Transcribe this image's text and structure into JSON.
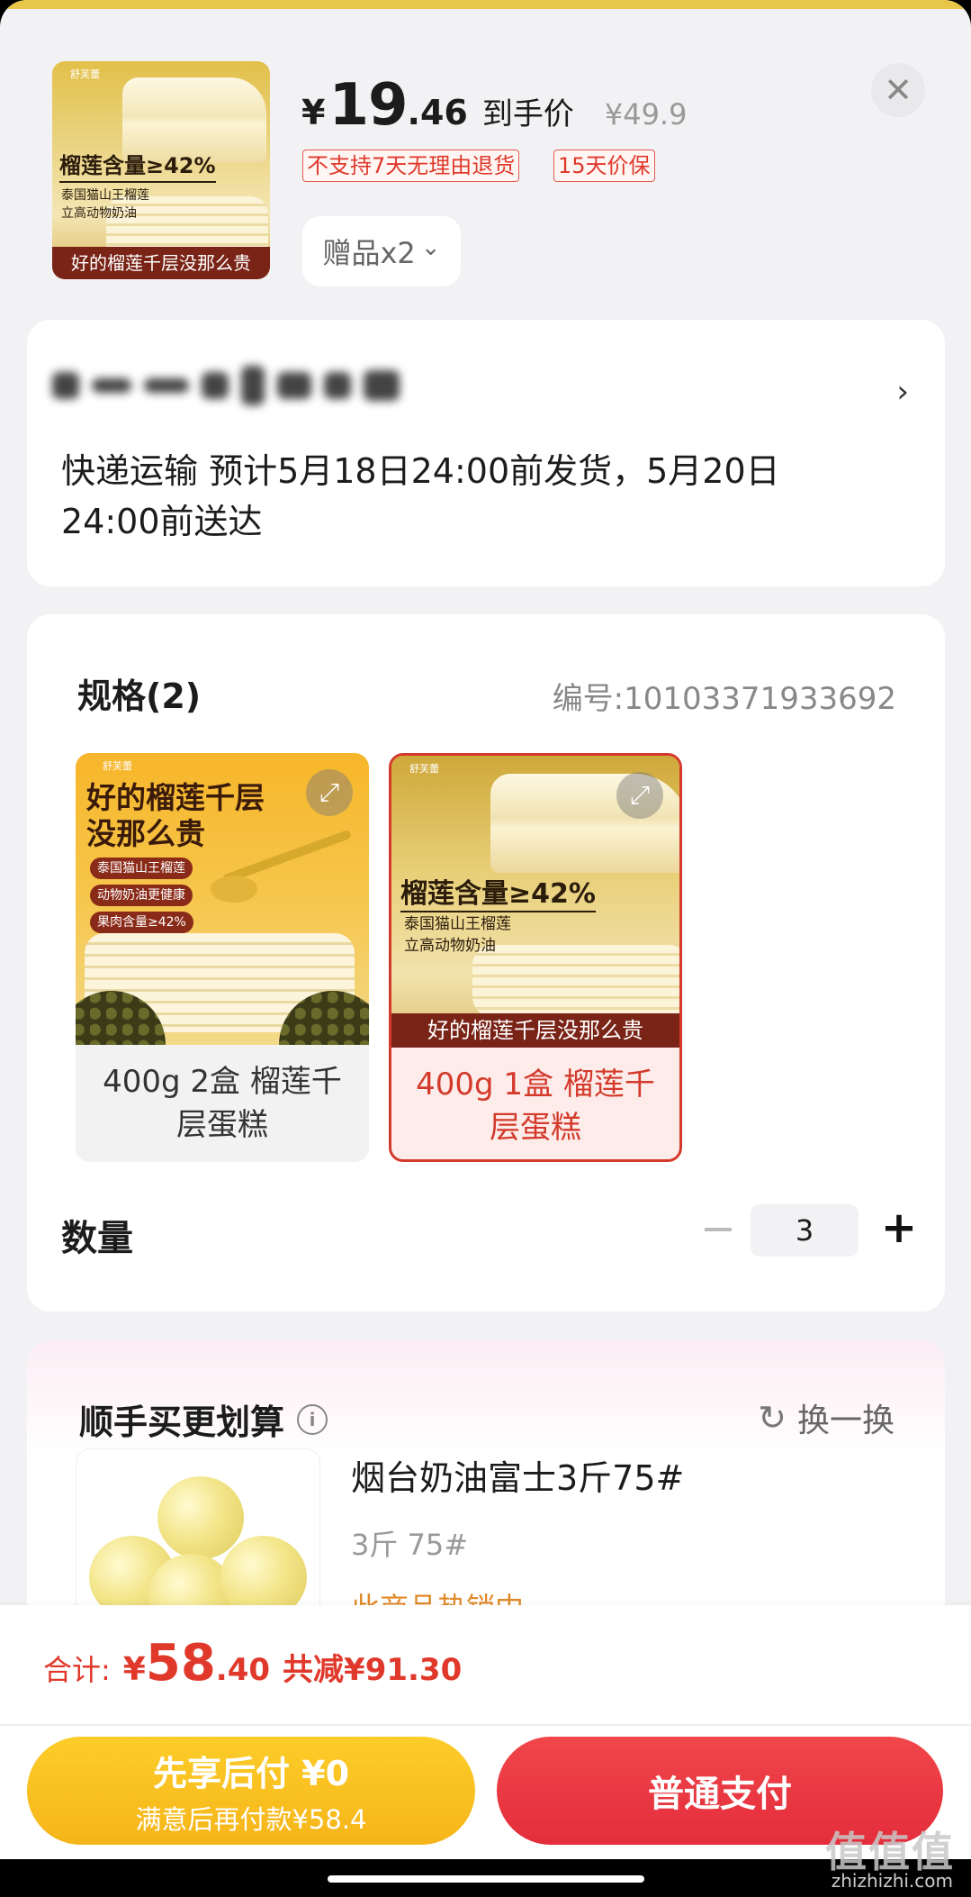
{
  "product": {
    "thumb_logo": "舒芙蕾",
    "thumb_headline": "榴莲含量≥42%",
    "thumb_sub1": "泰国猫山王榴莲",
    "thumb_sub2": "立高动物奶油",
    "thumb_banner": "好的榴莲千层没那么贵",
    "price_yen": "¥",
    "price_int": "19",
    "price_dec": ".46",
    "price_label": "到手价",
    "original_price": "¥49.9",
    "tags": [
      "不支持7天无理由退货",
      "15天价保"
    ],
    "gift_label": "赠品x2",
    "gift_chevron": "⌄",
    "close_glyph": "✕"
  },
  "address": {
    "arrow": "›",
    "shipping_text": "快递运输 预计5月18日24:00前发货，5月20日24:00前送达"
  },
  "spec": {
    "title": "规格(2)",
    "code": "编号:10103371933692",
    "options": [
      {
        "label": "400g 2盒 榴莲千层蛋糕",
        "logo": "舒芙蕾",
        "headline": "好的榴莲千层没那么贵",
        "pills": [
          "泰国猫山王榴莲",
          "动物奶油更健康",
          "果肉含量≥42%"
        ],
        "selected": false
      },
      {
        "label": "400g 1盒 榴莲千层蛋糕",
        "logo": "舒芙蕾",
        "headline": "榴莲含量≥42%",
        "sub1": "泰国猫山王榴莲",
        "sub2": "立高动物奶油",
        "banner": "好的榴莲千层没那么贵",
        "selected": true
      }
    ],
    "expand_glyph": "⤢"
  },
  "quantity": {
    "label": "数量",
    "minus": "−",
    "value": "3",
    "plus": "+"
  },
  "recommend": {
    "title": "顺手买更划算",
    "info_glyph": "i",
    "refresh_label": "换一换",
    "refresh_glyph": "↻",
    "item_name": "烟台奶油富士3斤75#",
    "item_spec": "3斤 75#",
    "item_status": "此商品热销中"
  },
  "checkout": {
    "total_label": "合计:",
    "total_yen": "¥",
    "total_int": "58",
    "total_dec": ".40",
    "total_saved": "共减¥91.30",
    "pay_later_line1": "先享后付 ¥0",
    "pay_later_line2": "满意后再付款¥58.4",
    "pay_normal": "普通支付"
  },
  "watermark": {
    "main": "值值值",
    "sub": "zhizhizhi.com"
  },
  "colors": {
    "accent_red": "#e0392b",
    "pay_yellow": "#f6b51a",
    "pay_red": "#e42d3c"
  }
}
